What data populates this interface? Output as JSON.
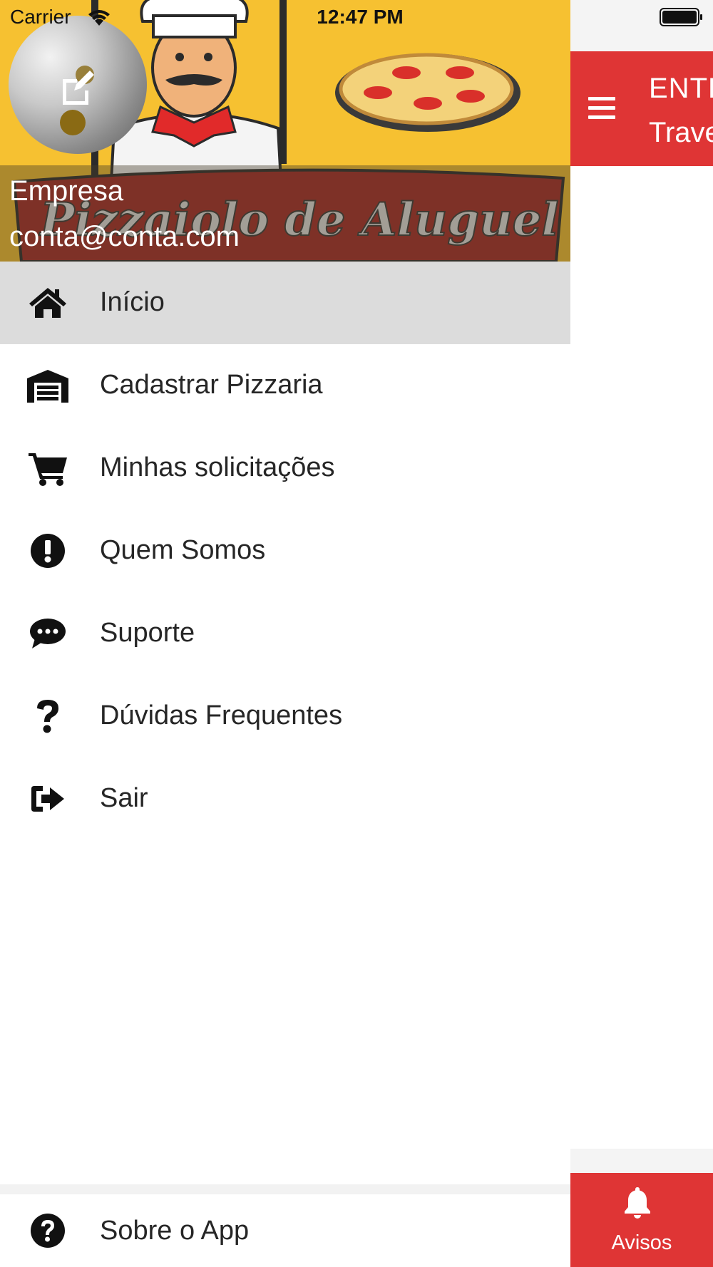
{
  "status_bar": {
    "carrier": "Carrier",
    "time": "12:47 PM"
  },
  "background_screen": {
    "header_title": "ENTR",
    "header_subtitle": "Trave",
    "header_color": "#df3535",
    "avisos_label": "Avisos"
  },
  "drawer": {
    "banner_text": "Pizzaiolo de Aluguel",
    "user": {
      "name": "Empresa",
      "email": "conta@conta.com"
    },
    "items": [
      {
        "label": "Início",
        "icon": "home-icon",
        "active": true
      },
      {
        "label": "Cadastrar Pizzaria",
        "icon": "warehouse-icon",
        "active": false
      },
      {
        "label": "Minhas solicitações",
        "icon": "shopping-cart-icon",
        "active": false
      },
      {
        "label": "Quem Somos",
        "icon": "exclamation-circle-icon",
        "active": false
      },
      {
        "label": "Suporte",
        "icon": "chat-bubble-icon",
        "active": false
      },
      {
        "label": "Dúvidas Frequentes",
        "icon": "question-mark-icon",
        "active": false
      },
      {
        "label": "Sair",
        "icon": "sign-out-icon",
        "active": false
      }
    ],
    "footer_item": {
      "label": "Sobre o App",
      "icon": "question-circle-icon"
    }
  },
  "colors": {
    "accent_red": "#df3535",
    "banner_yellow": "#f6c131",
    "active_item_bg": "#dcdcdc"
  }
}
